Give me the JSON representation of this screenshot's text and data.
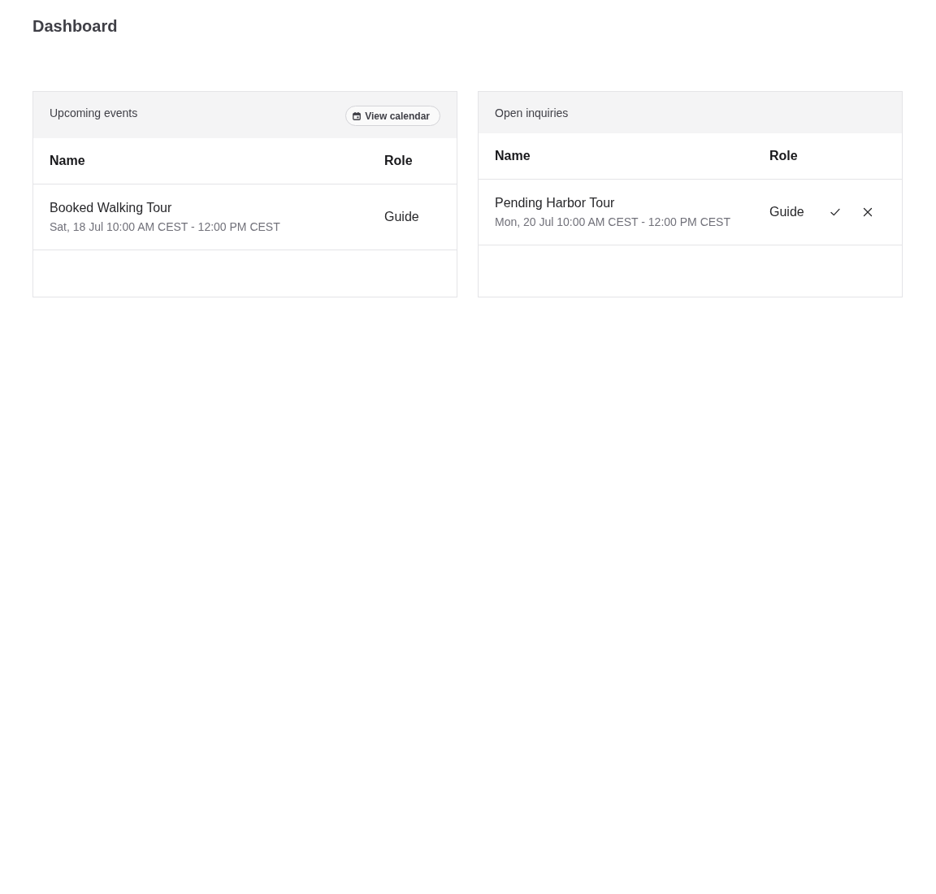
{
  "page": {
    "title": "Dashboard"
  },
  "panels": [
    {
      "kind": "events",
      "title": "Upcoming events",
      "header_button": {
        "label": "View calendar"
      },
      "columns": [
        "Name",
        "Role"
      ],
      "rows": [
        {
          "name": "Booked Walking Tour",
          "time": "Sat, 18 Jul 10:00 AM CEST - 12:00 PM CEST",
          "role": "Guide"
        }
      ]
    },
    {
      "kind": "inquiries",
      "title": "Open inquiries",
      "columns": [
        "Name",
        "Role"
      ],
      "rows": [
        {
          "name": "Pending Harbor Tour",
          "time": "Mon, 20 Jul 10:00 AM CEST - 12:00 PM CEST",
          "role": "Guide"
        }
      ]
    }
  ]
}
